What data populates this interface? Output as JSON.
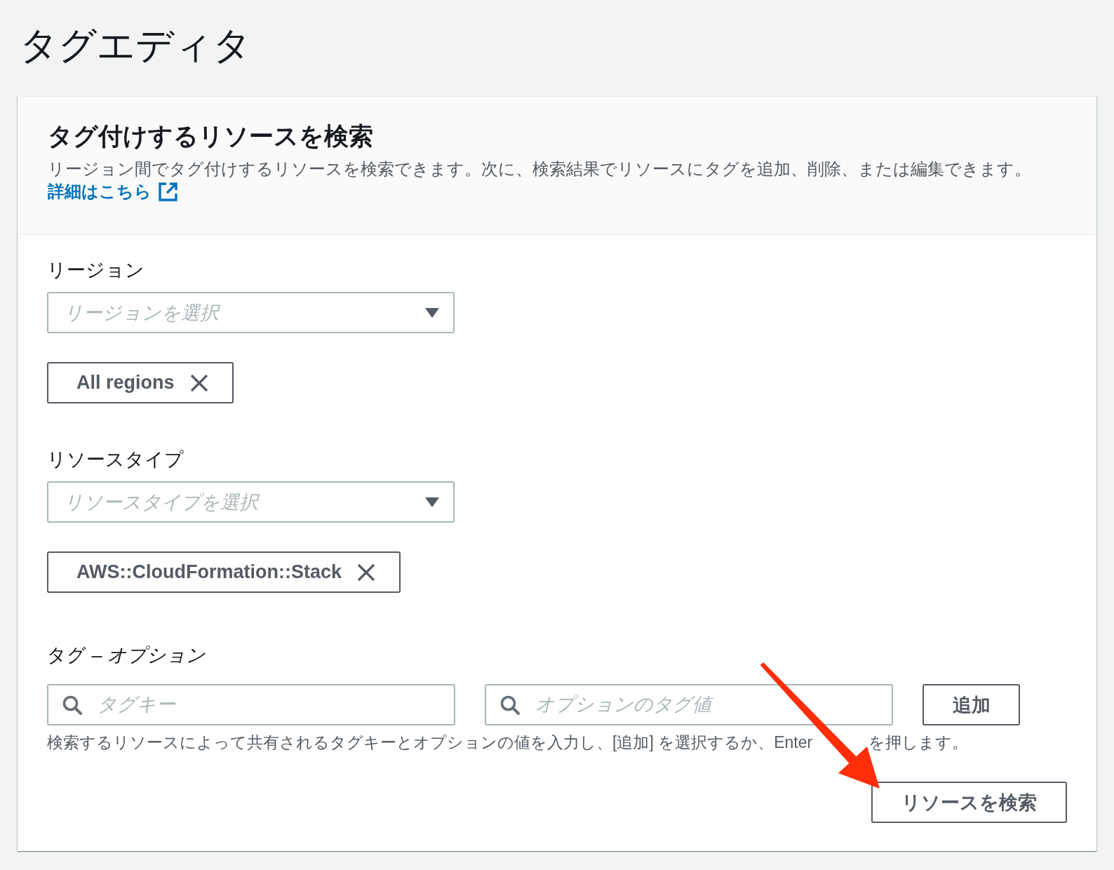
{
  "page": {
    "title": "タグエディタ"
  },
  "panel": {
    "heading": "タグ付けするリソースを検索",
    "description": "リージョン間でタグ付けするリソースを検索できます。次に、検索結果でリソースにタグを追加、削除、または編集できます。",
    "link": "詳細はこちら"
  },
  "filters": [
    {
      "label": "リージョン",
      "select": {
        "placeholder": "リージョンを選択"
      },
      "tokens": [
        {
          "label": "All regions"
        }
      ]
    },
    {
      "label": "リソースタイプ",
      "select": {
        "placeholder": "リソースタイプを選択"
      },
      "tokens": [
        {
          "label": "AWS::CloudFormation::Stack"
        }
      ]
    }
  ],
  "tags": {
    "label": "タグ – *オプション*",
    "key_field": {
      "placeholder": "タグキー"
    },
    "value_field": {
      "placeholder": "オプションのタグ値"
    },
    "add_button": "追加",
    "hint_parts": [
      "検索するリソースによって共有されるタグキーとオプションの値を入力し、[追加] を選択するか、Enter",
      "を押します。"
    ]
  },
  "search_button": "リソースを検索"
}
